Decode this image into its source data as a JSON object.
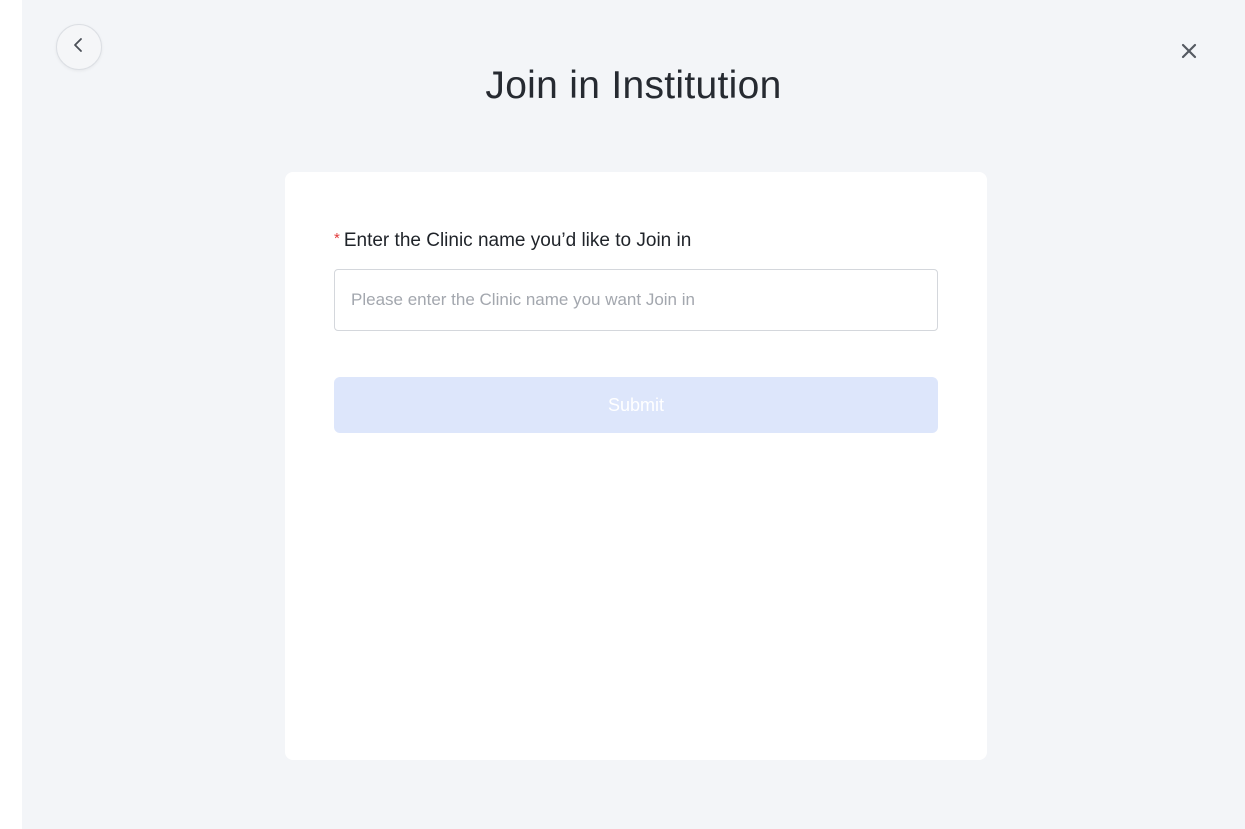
{
  "header": {
    "back_icon": "chevron-left-icon",
    "close_icon": "close-icon",
    "title": "Join in Institution"
  },
  "form": {
    "required_mark": "*",
    "clinic_label": "Enter the Clinic name you’d like to Join in",
    "clinic_value": "",
    "clinic_placeholder": "Please enter the Clinic name you want Join in",
    "submit_label": "Submit",
    "submit_enabled": false
  },
  "colors": {
    "page_background": "#f3f5f8",
    "card_background": "#ffffff",
    "required_mark": "#e23b3b",
    "submit_disabled_bg": "#dde6fb"
  }
}
